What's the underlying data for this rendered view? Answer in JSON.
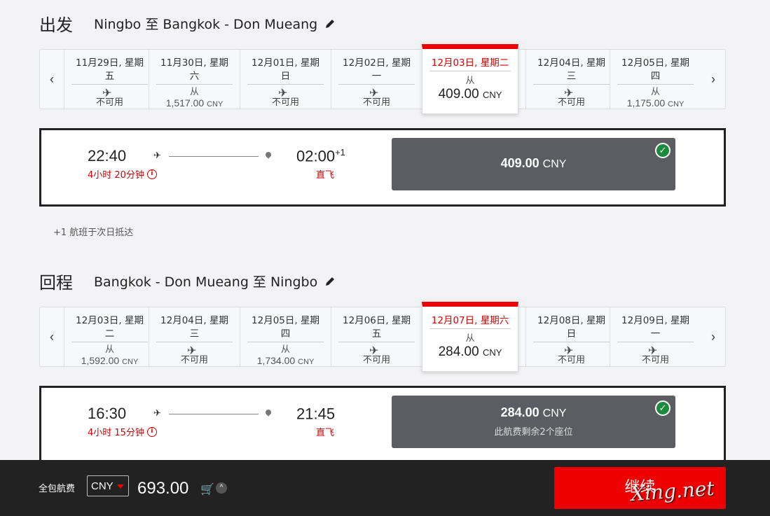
{
  "outbound": {
    "label": "出发",
    "route": "Ningbo 至 Bangkok - Don Mueang",
    "days": [
      {
        "date": "11月29日, 星期",
        "weekday": "五",
        "price": null,
        "unavailable": "不可用"
      },
      {
        "date": "11月30日, 星期",
        "weekday": "六",
        "from": "从",
        "price": "1,517.00",
        "currency": "CNY"
      },
      {
        "date": "12月01日, 星期",
        "weekday": "日",
        "price": null,
        "unavailable": "不可用"
      },
      {
        "date": "12月02日, 星期",
        "weekday": "一",
        "price": null,
        "unavailable": "不可用"
      },
      {
        "date": "12月03日, 星期二",
        "weekday": "",
        "from": "从",
        "price": "409.00",
        "currency": "CNY",
        "selected": true
      },
      {
        "date": "12月04日, 星期",
        "weekday": "三",
        "price": null,
        "unavailable": "不可用"
      },
      {
        "date": "12月05日, 星期",
        "weekday": "四",
        "from": "从",
        "price": "1,175.00",
        "currency": "CNY"
      }
    ],
    "flight": {
      "dep": "22:40",
      "duration": "4小时 20分钟",
      "arr": "02:00",
      "arr_sup": "+1",
      "type": "直飞",
      "price": "409.00",
      "currency": "CNY",
      "seats": ""
    }
  },
  "note": "+1 航班于次日抵达",
  "inbound": {
    "label": "回程",
    "route": "Bangkok - Don Mueang 至 Ningbo",
    "days": [
      {
        "date": "12月03日, 星期",
        "weekday": "二",
        "from": "从",
        "price": "1,592.00",
        "currency": "CNY"
      },
      {
        "date": "12月04日, 星期",
        "weekday": "三",
        "price": null,
        "unavailable": "不可用"
      },
      {
        "date": "12月05日, 星期",
        "weekday": "四",
        "from": "从",
        "price": "1,734.00",
        "currency": "CNY"
      },
      {
        "date": "12月06日, 星期",
        "weekday": "五",
        "price": null,
        "unavailable": "不可用"
      },
      {
        "date": "12月07日, 星期六",
        "weekday": "",
        "from": "从",
        "price": "284.00",
        "currency": "CNY",
        "selected": true
      },
      {
        "date": "12月08日, 星期",
        "weekday": "日",
        "price": null,
        "unavailable": "不可用"
      },
      {
        "date": "12月09日, 星期",
        "weekday": "一",
        "price": null,
        "unavailable": "不可用"
      }
    ],
    "flight": {
      "dep": "16:30",
      "duration": "4小时 15分钟",
      "arr": "21:45",
      "arr_sup": "",
      "type": "直飞",
      "price": "284.00",
      "currency": "CNY",
      "seats": "此航费剩余2个座位"
    }
  },
  "footer": {
    "total_label": "全包航费",
    "currency": "CNY",
    "amount": "693.00",
    "continue": "继续",
    "watermark": "Xing.net"
  },
  "icons": {
    "prev": "chevron-left-icon",
    "next": "chevron-right-icon",
    "edit": "pencil-icon",
    "plane": "plane-icon",
    "pin": "location-pin-icon",
    "check": "check-icon",
    "cart": "cart-icon",
    "info": "info-icon"
  },
  "colors": {
    "accent": "#e00000",
    "selected_price_box": "#5b5d62",
    "check": "#1a8a3e",
    "footer": "#222222"
  }
}
